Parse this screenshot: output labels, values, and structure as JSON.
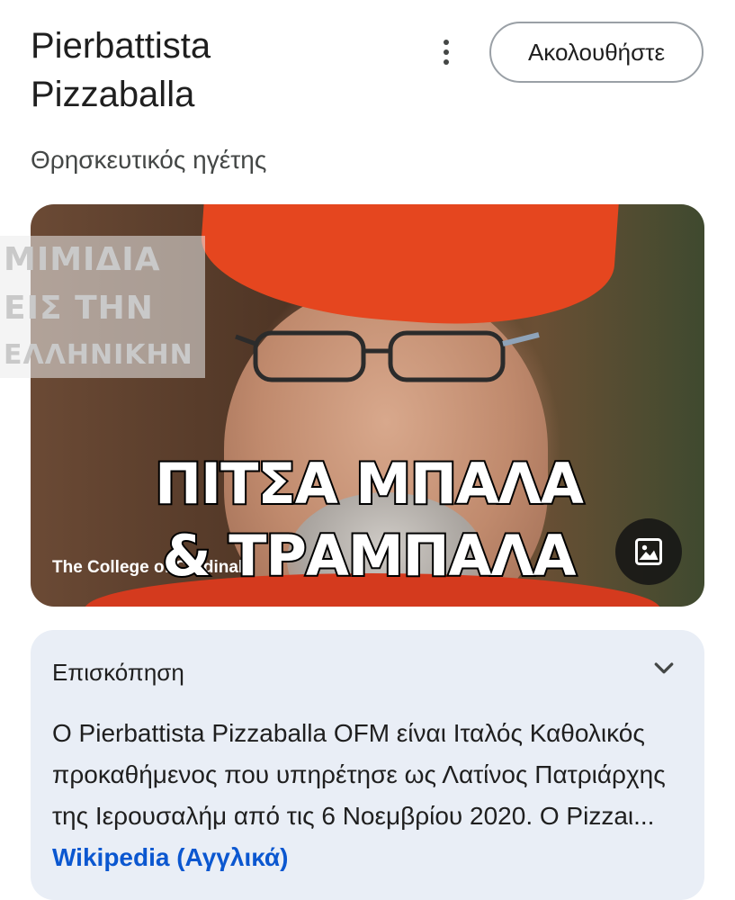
{
  "header": {
    "title": "Pierbattista Pizzaballa",
    "subtitle": "Θρησκευτικός ηγέτης",
    "follow_label": "Ακολουθήστε",
    "menu_icon": "more-vert-icon"
  },
  "hero": {
    "watermark": [
      "ΜΙΜΙΔΙΑ",
      "ΕΙΣ ΤΗΝ",
      "ΕΛΛΗΝΙΚΗΝ"
    ],
    "caption": "The College of Cardinals",
    "meme_text": [
      "ΠΙΤΣΑ ΜΠΑΛΑ",
      "& ΤΡΑΜΠΑΛΑ"
    ],
    "image_icon": "image-icon"
  },
  "overview": {
    "title": "Επισκόπηση",
    "body": "Ο Pierbattista Pizzaballa OFM είναι Ιταλός Καθολικός προκαθήμενος που υπηρέτησε ως Λατίνος Πατριάρχης της Ιερουσαλήμ από τις 6 Νοεμβρίου 2020. Ο Pizzaι...",
    "link": "Wikipedia (Αγγλικά)"
  },
  "colors": {
    "accent_link": "#0b57d0",
    "card_bg": "#e9eef6",
    "hat_red": "#e5461f"
  }
}
